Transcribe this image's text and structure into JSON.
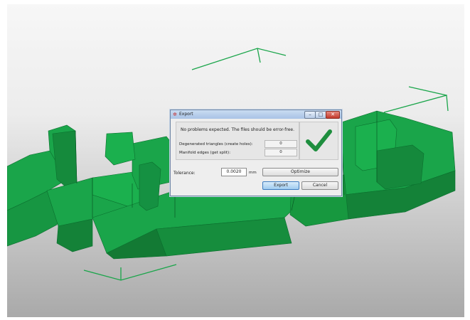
{
  "dialog": {
    "title": "Export",
    "minimize_glyph": "–",
    "maximize_glyph": "□",
    "close_glyph": "✕",
    "message": "No problems expected. The files should be error-free.",
    "degenerated_label": "Degenerated triangles (create holes):",
    "degenerated_value": "0",
    "manifold_label": "Manifold edges (get split):",
    "manifold_value": "0",
    "tolerance_label": "Tolerance:",
    "tolerance_value": "0.0020",
    "tolerance_unit": "mm",
    "optimize_label": "Optimize",
    "export_label": "Export",
    "cancel_label": "Cancel",
    "status_icon": "checkmark-icon",
    "status_color": "#1e8e3e"
  },
  "viewport": {
    "model_color": "#1aa54a"
  }
}
